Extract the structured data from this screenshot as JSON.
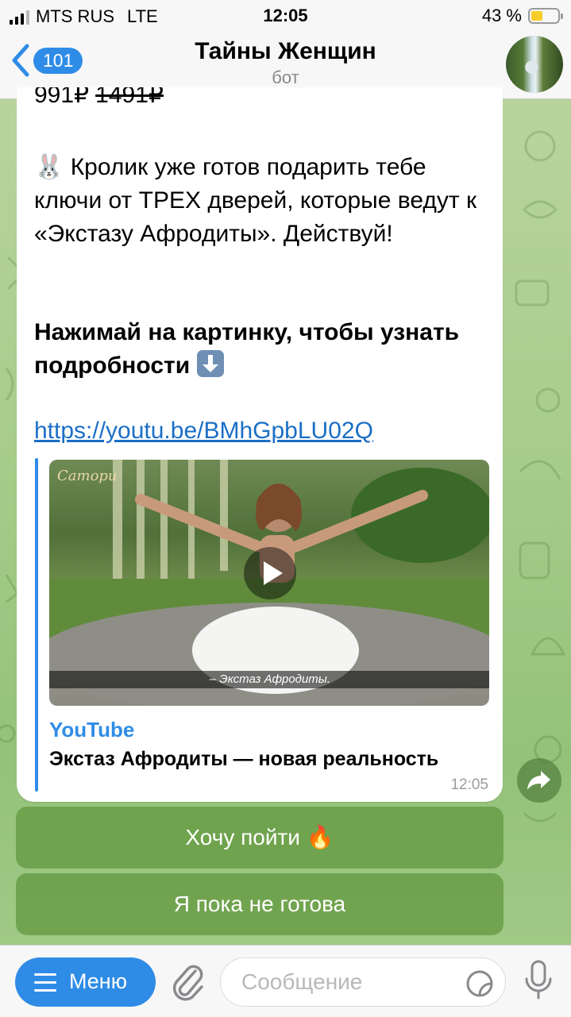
{
  "status_bar": {
    "carrier": "MTS RUS",
    "network": "LTE",
    "time": "12:05",
    "battery": "43 %",
    "battery_level": 0.43
  },
  "header": {
    "back_count": "101",
    "title": "Тайны Женщин",
    "subtitle": "бот"
  },
  "message": {
    "price_new": "991₽",
    "price_old": "1491₽",
    "paragraph1": "🐰 Кролик уже готов подарить тебе ключи от ТРЕХ дверей, которые ведут к «Экстазу Афродиты». Действуй!",
    "paragraph2": "Нажимай на картинку, чтобы узнать подробности",
    "link": "https://youtu.be/BMhGpbLU02Q",
    "preview": {
      "brand": "Сатори",
      "caption": "– Экстаз Афродиты.",
      "site": "YouTube",
      "title": "Экстаз Афродиты — новая реальность"
    },
    "time": "12:05"
  },
  "inline_buttons": [
    {
      "label": "Хочу пойти 🔥"
    },
    {
      "label": "Я пока не готова"
    }
  ],
  "bottom_bar": {
    "menu_label": "Меню",
    "message_placeholder": "Сообщение"
  },
  "icons": {
    "back": "chevron-left-icon",
    "forward": "share-arrow-icon",
    "attach": "paperclip-icon",
    "sticker": "sticker-icon",
    "mic": "microphone-icon",
    "play": "play-icon",
    "menu": "hamburger-icon"
  },
  "colors": {
    "accent": "#2f8ce6",
    "link": "#1b6fc6",
    "button_bg": "#6c9c48"
  }
}
